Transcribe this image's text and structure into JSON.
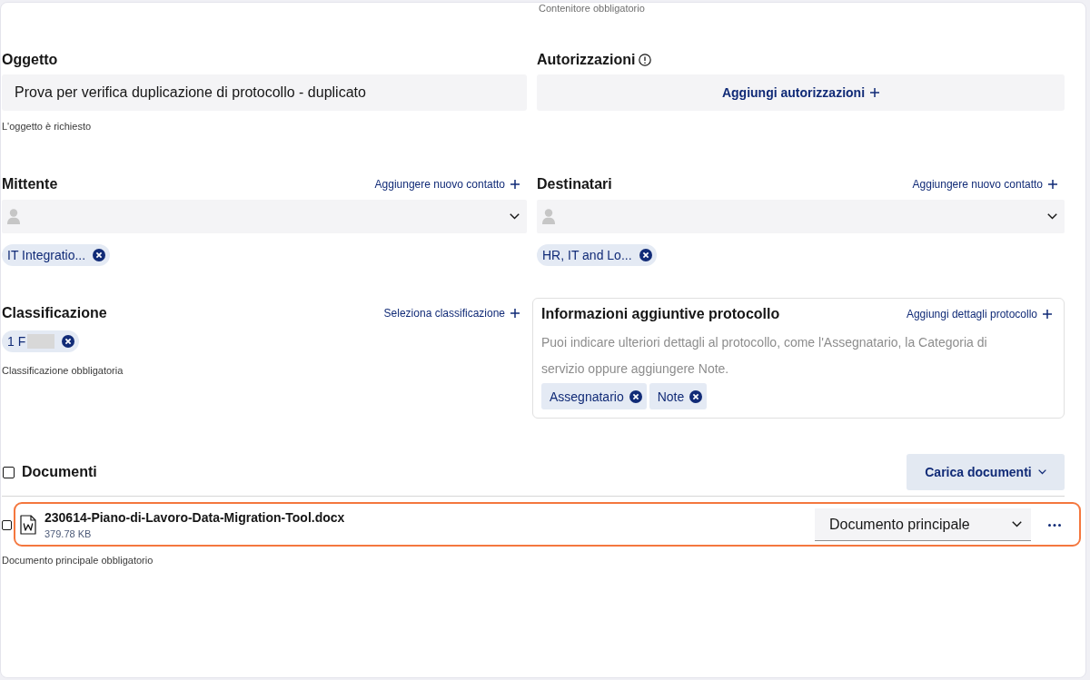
{
  "container_hint": "Contenitore obbligatorio",
  "subject": {
    "label": "Oggetto",
    "value": "Prova per verifica duplicazione di protocollo - duplicato",
    "hint": "L'oggetto è richiesto"
  },
  "authorizations": {
    "label": "Autorizzazioni",
    "button": "Aggiungi autorizzazioni"
  },
  "sender": {
    "label": "Mittente",
    "add_link": "Aggiungere nuovo contatto",
    "chips": [
      {
        "label": "IT Integratio..."
      }
    ]
  },
  "recipients": {
    "label": "Destinatari",
    "add_link": "Aggiungere nuovo contatto",
    "chips": [
      {
        "label": "HR, IT and Lo..."
      }
    ]
  },
  "classification": {
    "label": "Classificazione",
    "add_link": "Seleziona classificazione",
    "chips": [
      {
        "label": "1 F",
        "redacted": true
      }
    ],
    "hint": "Classificazione obbligatoria"
  },
  "additional_info": {
    "title": "Informazioni aggiuntive protocollo",
    "add_link": "Aggiungi dettagli protocollo",
    "description": "Puoi indicare ulteriori dettagli al protocollo, come l'Assegnatario, la Categoria di servizio oppure aggiungere Note.",
    "tags": [
      {
        "label": "Assegnatario"
      },
      {
        "label": "Note"
      }
    ]
  },
  "documents": {
    "label": "Documenti",
    "checked": false,
    "upload_button": "Carica documenti",
    "files": [
      {
        "name": "230614-Piano-di-Lavoro-Data-Migration-Tool.docx",
        "size": "379.78 KB",
        "checked": false,
        "highlighted": true,
        "role": "Documento principale"
      }
    ],
    "hint": "Documento principale obbligatorio"
  }
}
